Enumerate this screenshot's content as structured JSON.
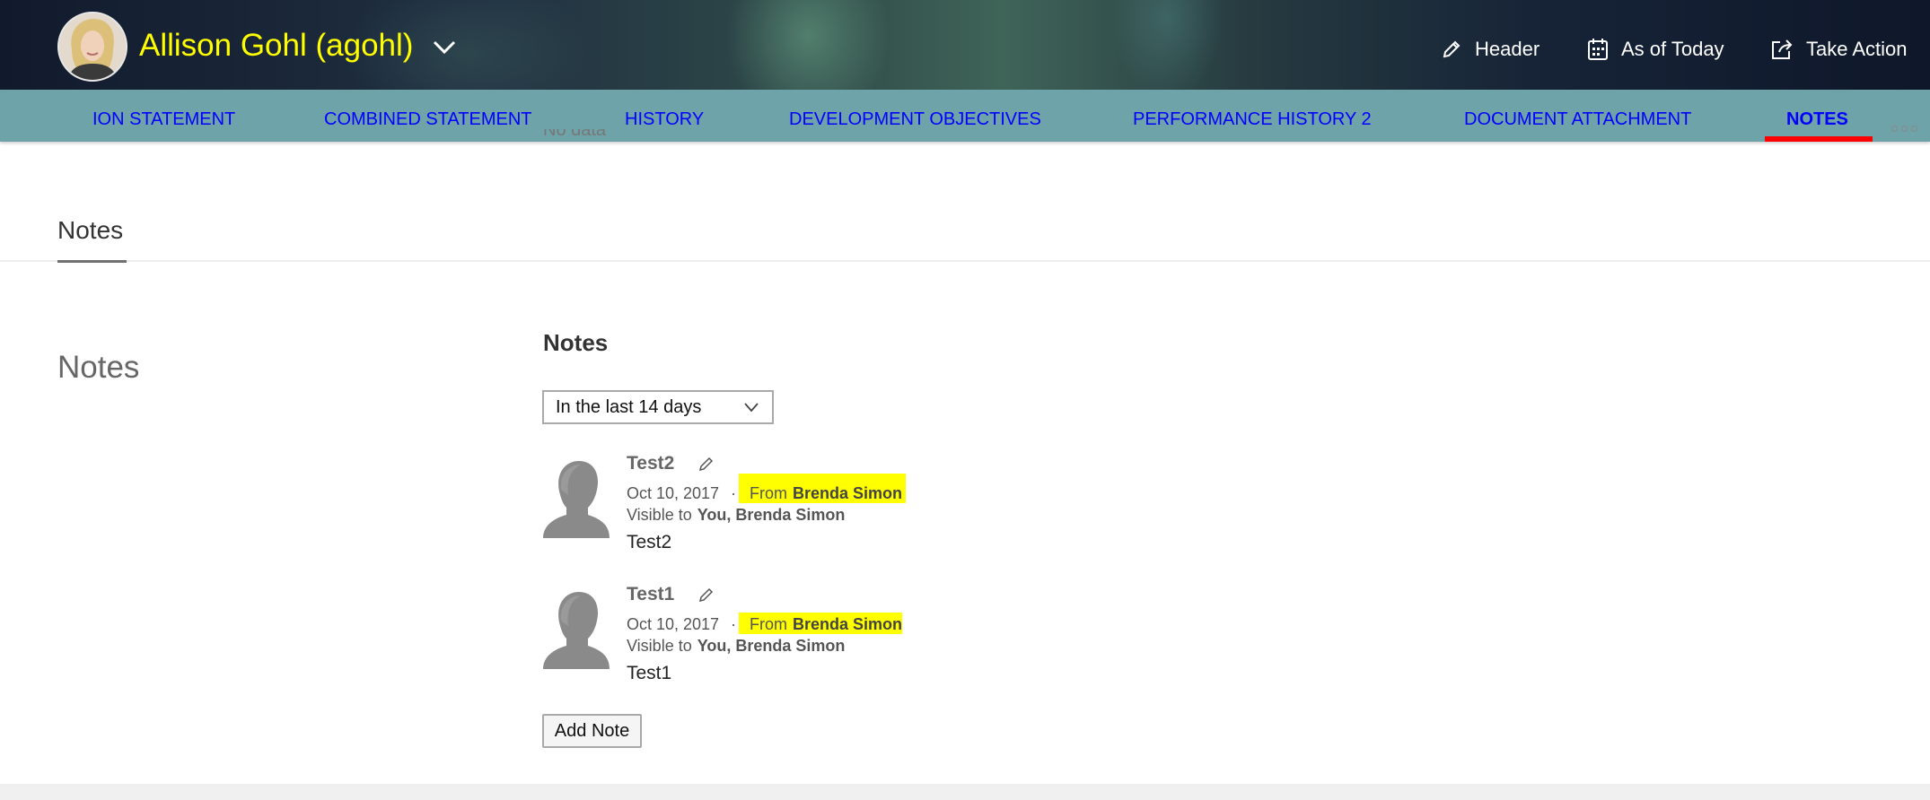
{
  "header": {
    "user_name": "Allison Gohl (agohl)",
    "actions": [
      {
        "label": "Header",
        "icon": "pencil-icon"
      },
      {
        "label": "As of Today",
        "icon": "calendar-icon"
      },
      {
        "label": "Take Action",
        "icon": "external-link-icon"
      }
    ]
  },
  "tabs": [
    {
      "label": "ION STATEMENT",
      "active": false
    },
    {
      "label": "COMBINED STATEMENT",
      "active": false
    },
    {
      "label": "HISTORY",
      "active": false
    },
    {
      "label": "DEVELOPMENT OBJECTIVES",
      "active": false
    },
    {
      "label": "PERFORMANCE HISTORY 2",
      "active": false
    },
    {
      "label": "DOCUMENT ATTACHMENT",
      "active": false
    },
    {
      "label": "NOTES",
      "active": true
    }
  ],
  "content": {
    "no_data_text": "No data",
    "section_tab": "Notes",
    "side_title": "Notes",
    "panel_title": "Notes",
    "filter": {
      "selected": "In the last 14 days"
    },
    "notes": [
      {
        "title": "Test2",
        "date": "Oct 10, 2017",
        "separator": "·",
        "from_label": "From",
        "from_name": "Brenda Simon",
        "visible_label": "Visible to",
        "visible_to": "You, Brenda Simon",
        "body": "Test2"
      },
      {
        "title": "Test1",
        "date": "Oct 10, 2017",
        "separator": "·",
        "from_label": "From",
        "from_name": "Brenda Simon",
        "visible_label": "Visible to",
        "visible_to": "You, Brenda Simon",
        "body": "Test1"
      }
    ],
    "add_note_label": "Add Note"
  },
  "colors": {
    "highlight": "#ffff00",
    "tab_bar": "#6ea3a9",
    "tab_text": "#0000ff",
    "active_underline": "#ff0000",
    "name_color": "#ffff00"
  }
}
